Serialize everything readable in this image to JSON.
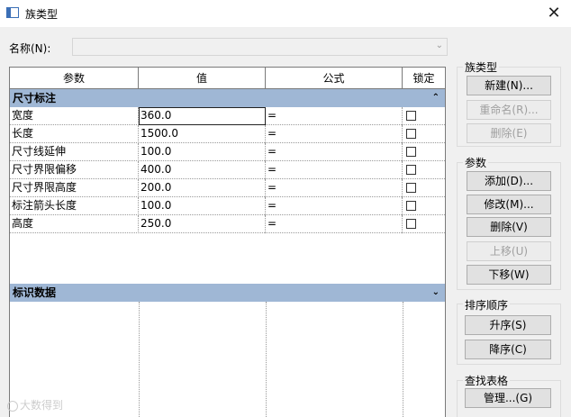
{
  "window": {
    "title": "族类型",
    "close_glyph": "✕"
  },
  "name_field": {
    "label": "名称(N):",
    "value": ""
  },
  "grid": {
    "headers": {
      "param": "参数",
      "value": "值",
      "formula": "公式",
      "lock": "锁定"
    },
    "groups": [
      {
        "label": "尺寸标注",
        "caret": "⌃",
        "expanded": true
      },
      {
        "label": "标识数据",
        "caret": "⌄",
        "expanded": false
      }
    ],
    "rows": [
      {
        "param": "宽度",
        "value": "360.0",
        "formula": "=",
        "locked": false
      },
      {
        "param": "长度",
        "value": "1500.0",
        "formula": "=",
        "locked": false
      },
      {
        "param": "尺寸线延伸",
        "value": "100.0",
        "formula": "=",
        "locked": false
      },
      {
        "param": "尺寸界限偏移",
        "value": "400.0",
        "formula": "=",
        "locked": false
      },
      {
        "param": "尺寸界限高度",
        "value": "200.0",
        "formula": "=",
        "locked": false
      },
      {
        "param": "标注箭头长度",
        "value": "100.0",
        "formula": "=",
        "locked": false
      },
      {
        "param": "高度",
        "value": "250.0",
        "formula": "=",
        "locked": false
      }
    ]
  },
  "panels": {
    "family_types": {
      "title": "族类型",
      "new": "新建(N)...",
      "rename": "重命名(R)...",
      "delete": "删除(E)"
    },
    "params": {
      "title": "参数",
      "add": "添加(D)...",
      "modify": "修改(M)...",
      "delete": "删除(V)",
      "move_up": "上移(U)",
      "move_down": "下移(W)"
    },
    "sort": {
      "title": "排序顺序",
      "asc": "升序(S)",
      "desc": "降序(C)"
    },
    "lookup": {
      "title": "查找表格",
      "manage": "管理...(G)"
    }
  },
  "watermark": {
    "text": "大数得到"
  },
  "colors": {
    "group_header_bg": "#9fb7d5",
    "dialog_bg": "#f0f0f0"
  }
}
